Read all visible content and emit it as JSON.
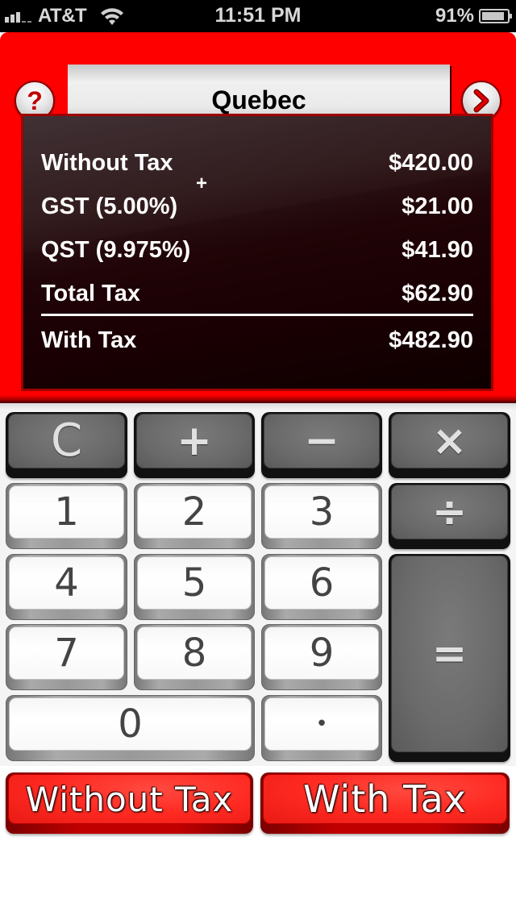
{
  "status_bar": {
    "carrier": "AT&T",
    "time": "11:51 PM",
    "battery_percent": "91%",
    "battery_level": 0.91,
    "signal_bars": 3,
    "icons": [
      "signal-icon",
      "wifi-icon",
      "battery-icon"
    ]
  },
  "header": {
    "title": "Quebec",
    "help_button": {
      "icon": "question-mark-icon",
      "glyph": "?"
    },
    "next_button": {
      "icon": "chevron-right-icon"
    },
    "accent_color": "#ff0000"
  },
  "display": {
    "rows": [
      {
        "label": "Without Tax",
        "amount": "$420.00"
      },
      {
        "label": "GST (5.00%)",
        "amount": "$21.00"
      },
      {
        "label": "QST (9.975%)",
        "amount": "$41.90"
      },
      {
        "label": "Total Tax",
        "amount": "$62.90"
      },
      {
        "label": "With Tax",
        "amount": "$482.90"
      }
    ],
    "operator_indicator": "+"
  },
  "keypad": {
    "clear": "C",
    "plus": "+",
    "minus": "−",
    "multiply": "×",
    "divide": "÷",
    "equals": "=",
    "digits": [
      "0",
      "1",
      "2",
      "3",
      "4",
      "5",
      "6",
      "7",
      "8",
      "9"
    ],
    "decimal": "•"
  },
  "tax_buttons": {
    "without_tax": "Without Tax",
    "with_tax": "With Tax"
  }
}
